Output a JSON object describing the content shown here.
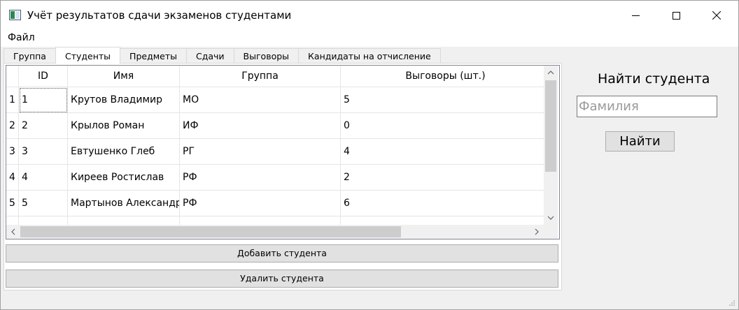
{
  "window": {
    "title": "Учёт результатов сдачи экзаменов студентами"
  },
  "menu": {
    "file": "Файл"
  },
  "tabs": [
    {
      "label": "Группа"
    },
    {
      "label": "Студенты"
    },
    {
      "label": "Предметы"
    },
    {
      "label": "Сдачи"
    },
    {
      "label": "Выговоры"
    },
    {
      "label": "Кандидаты на отчисление"
    }
  ],
  "table": {
    "columns": [
      "ID",
      "Имя",
      "Группа",
      "Выговоры (шт.)"
    ],
    "rows": [
      {
        "num": "1",
        "id": "1",
        "name": "Крутов Владимир",
        "group": "МО",
        "reprimands": "5"
      },
      {
        "num": "2",
        "id": "2",
        "name": "Крылов Роман",
        "group": "ИФ",
        "reprimands": "0"
      },
      {
        "num": "3",
        "id": "3",
        "name": "Евтушенко Глеб",
        "group": "РГ",
        "reprimands": "4"
      },
      {
        "num": "4",
        "id": "4",
        "name": "Киреев Ростислав",
        "group": "РФ",
        "reprimands": "2"
      },
      {
        "num": "5",
        "id": "5",
        "name": "Мартынов Александр",
        "group": "РФ",
        "reprimands": "6"
      }
    ]
  },
  "actions": {
    "add_student": "Добавить студента",
    "delete_student": "Удалить студента"
  },
  "search": {
    "title": "Найти студента",
    "placeholder": "Фамилия",
    "value": "",
    "button": "Найти"
  }
}
